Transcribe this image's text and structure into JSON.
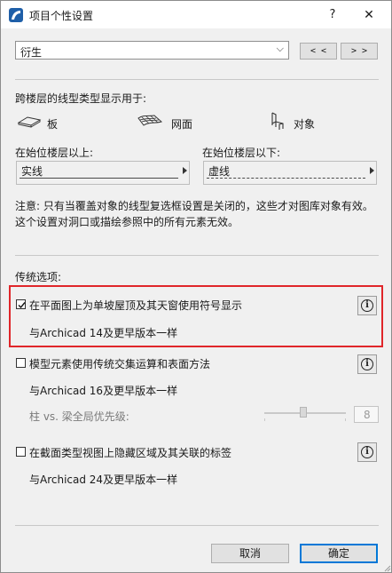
{
  "window": {
    "title": "项目个性设置"
  },
  "titlebar": {
    "help": "?",
    "close": "✕"
  },
  "topbar": {
    "select_value": "衍生",
    "prev_label": "< <",
    "next_label": "> >"
  },
  "linetype": {
    "heading": "跨楼层的线型类型显示用于:",
    "types": [
      {
        "label": "板",
        "icon": "slab-icon"
      },
      {
        "label": "网面",
        "icon": "mesh-icon"
      },
      {
        "label": "对象",
        "icon": "chair-object-icon"
      }
    ],
    "above": {
      "label": "在始位楼层以上:",
      "value": "实线"
    },
    "below": {
      "label": "在始位楼层以下:",
      "value": "虚线"
    },
    "note_line1": "注意: 只有当覆盖对象的线型复选框设置是关闭的，这些才对图库对象有效。",
    "note_line2": "这个设置对洞口或描绘参照中的所有元素无效。"
  },
  "legacy": {
    "heading": "传统选项:",
    "options": [
      {
        "label": "在平面图上为单坡屋顶及其天窗使用符号显示",
        "sub": "与Archicad 14及更早版本一样",
        "checked": true
      },
      {
        "label": "模型元素使用传统交集运算和表面方法",
        "sub": "与Archicad 16及更早版本一样",
        "checked": false
      },
      {
        "label": "在截面类型视图上隐藏区域及其关联的标签",
        "sub": "与Archicad 24及更早版本一样",
        "checked": false
      }
    ],
    "priority_label": "柱 vs. 梁全局优先级:",
    "priority_value": "8",
    "info_glyph": "i"
  },
  "footer": {
    "cancel": "取消",
    "ok": "确定"
  },
  "colors": {
    "highlight": "#e0262a",
    "accent": "#0078d7",
    "app_icon": "#1f5fa8"
  }
}
